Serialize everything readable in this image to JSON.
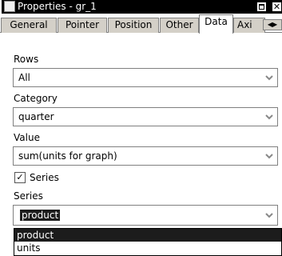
{
  "window": {
    "title": "Properties - gr_1",
    "close_glyph": "✕"
  },
  "tabs": [
    {
      "label": "General"
    },
    {
      "label": "Pointer"
    },
    {
      "label": "Position"
    },
    {
      "label": "Other"
    },
    {
      "label": "Data",
      "active": true
    },
    {
      "label": "Axi"
    }
  ],
  "tab_scroll": {
    "left": "◀",
    "right": "▶"
  },
  "rows": {
    "label": "Rows",
    "value": "All"
  },
  "category": {
    "label": "Category",
    "value": "quarter"
  },
  "value": {
    "label": "Value",
    "value": "sum(units for graph)"
  },
  "series_checkbox": {
    "label": "Series",
    "checked": true,
    "mark": "✓"
  },
  "series": {
    "label": "Series",
    "value": "product",
    "options": [
      "product",
      "units"
    ],
    "highlighted": "product"
  },
  "icons": [
    "app-icon",
    "maximize-icon",
    "close-icon",
    "tab-scroll-left-icon",
    "tab-scroll-right-icon",
    "dropdown-arrow-icon",
    "checkmark-icon"
  ]
}
